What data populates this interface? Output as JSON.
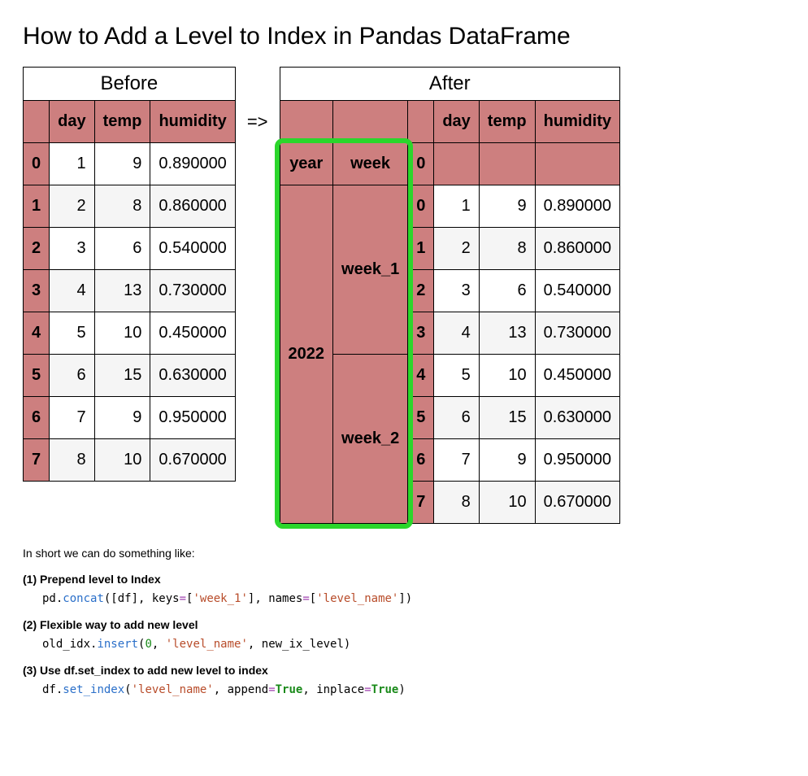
{
  "title": "How to Add a Level to Index in Pandas DataFrame",
  "arrow": "=>",
  "before": {
    "caption": "Before",
    "columns": [
      "day",
      "temp",
      "humidity"
    ],
    "rows": [
      {
        "idx": "0",
        "day": "1",
        "temp": "9",
        "humidity": "0.890000"
      },
      {
        "idx": "1",
        "day": "2",
        "temp": "8",
        "humidity": "0.860000"
      },
      {
        "idx": "2",
        "day": "3",
        "temp": "6",
        "humidity": "0.540000"
      },
      {
        "idx": "3",
        "day": "4",
        "temp": "13",
        "humidity": "0.730000"
      },
      {
        "idx": "4",
        "day": "5",
        "temp": "10",
        "humidity": "0.450000"
      },
      {
        "idx": "5",
        "day": "6",
        "temp": "15",
        "humidity": "0.630000"
      },
      {
        "idx": "6",
        "day": "7",
        "temp": "9",
        "humidity": "0.950000"
      },
      {
        "idx": "7",
        "day": "8",
        "temp": "10",
        "humidity": "0.670000"
      }
    ]
  },
  "after": {
    "caption": "After",
    "columns": [
      "day",
      "temp",
      "humidity"
    ],
    "levels": {
      "year": "year",
      "week": "week",
      "zero": "0"
    },
    "year_value": "2022",
    "week1": "week_1",
    "week2": "week_2",
    "rows": [
      {
        "idx": "0",
        "day": "1",
        "temp": "9",
        "humidity": "0.890000"
      },
      {
        "idx": "1",
        "day": "2",
        "temp": "8",
        "humidity": "0.860000"
      },
      {
        "idx": "2",
        "day": "3",
        "temp": "6",
        "humidity": "0.540000"
      },
      {
        "idx": "3",
        "day": "4",
        "temp": "13",
        "humidity": "0.730000"
      },
      {
        "idx": "4",
        "day": "5",
        "temp": "10",
        "humidity": "0.450000"
      },
      {
        "idx": "5",
        "day": "6",
        "temp": "15",
        "humidity": "0.630000"
      },
      {
        "idx": "6",
        "day": "7",
        "temp": "9",
        "humidity": "0.950000"
      },
      {
        "idx": "7",
        "day": "8",
        "temp": "10",
        "humidity": "0.670000"
      }
    ]
  },
  "summary": "In short we can do something like:",
  "steps": {
    "s1": "(1) Prepend level to Index",
    "s2": "(2) Flexible way to add new level",
    "s3": "(3) Use df.set_index to add new level to index"
  },
  "code": {
    "c1": {
      "a": "pd.",
      "fn": "concat",
      "b": "([df], keys",
      "op1": "=",
      "c": "[",
      "str1": "'week_1'",
      "d": "], names",
      "op2": "=",
      "e": "[",
      "str2": "'level_name'",
      "f": "])"
    },
    "c2": {
      "a": "old_idx.",
      "fn": "insert",
      "b": "(",
      "num": "0",
      "c": ", ",
      "str": "'level_name'",
      "d": ", new_ix_level)"
    },
    "c3": {
      "a": "df.",
      "fn": "set_index",
      "b": "(",
      "str": "'level_name'",
      "c": ", append",
      "op1": "=",
      "bool1": "True",
      "d": ", inplace",
      "op2": "=",
      "bool2": "True",
      "e": ")"
    }
  }
}
